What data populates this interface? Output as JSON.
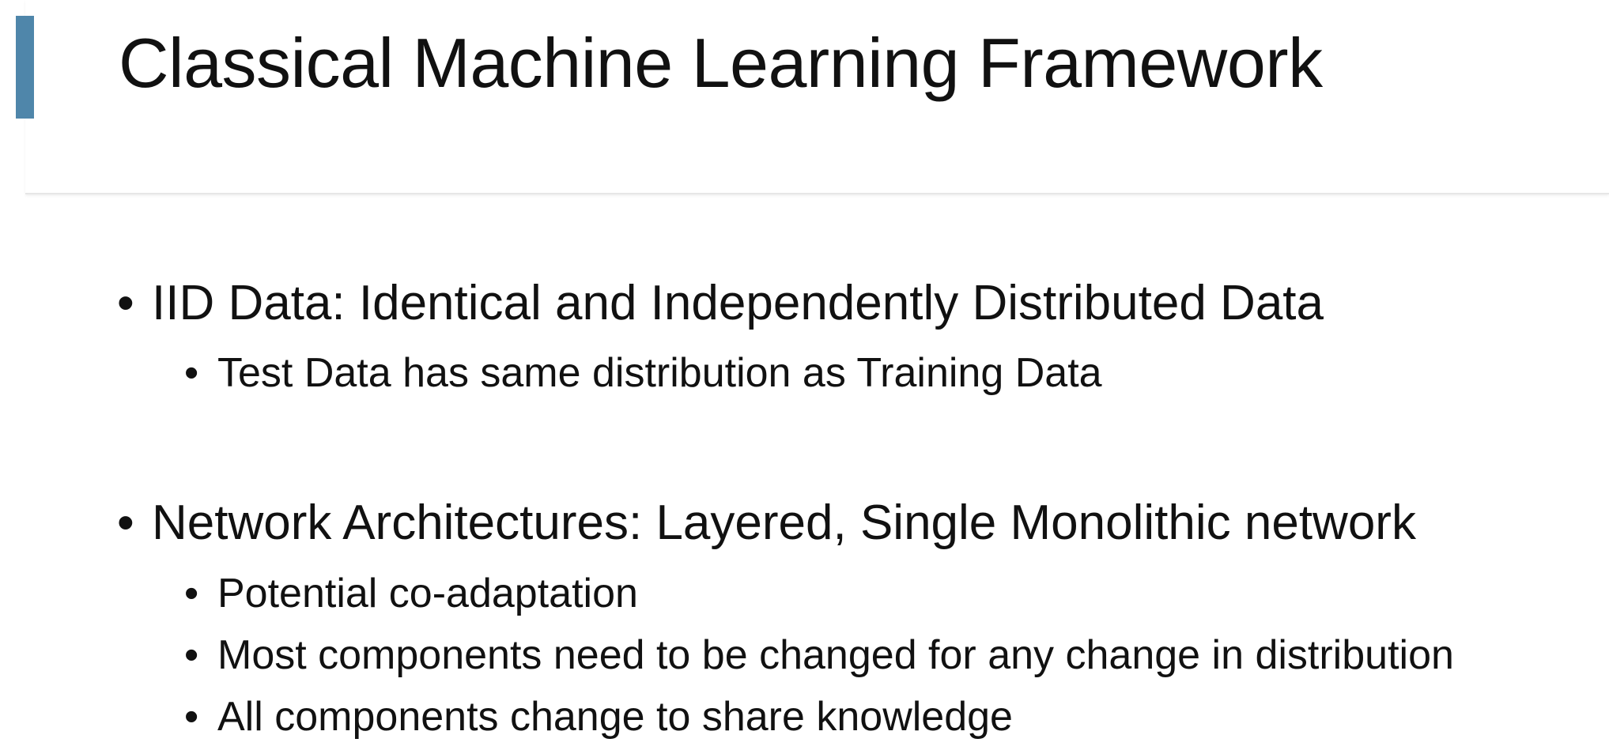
{
  "slide": {
    "title": "Classical Machine Learning Framework",
    "accent_color": "#4f86aa",
    "bullet_glyph": "•",
    "sections": [
      {
        "text": "IID Data: Identical and Independently Distributed Data",
        "subitems": [
          "Test Data has same distribution as Training Data"
        ]
      },
      {
        "text": "Network Architectures: Layered, Single Monolithic network",
        "subitems": [
          "Potential co-adaptation",
          "Most components need to be changed for any change in distribution",
          "All components change to share knowledge"
        ]
      }
    ]
  }
}
